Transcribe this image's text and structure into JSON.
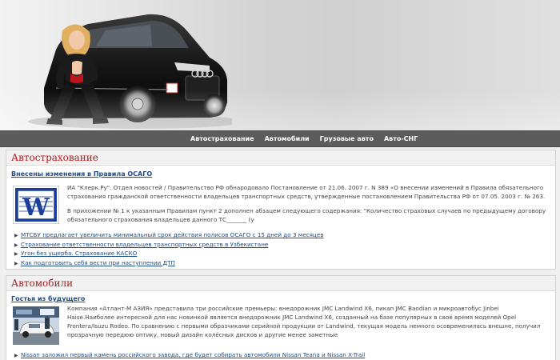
{
  "nav": {
    "items": [
      "Автострахование",
      "Автомобили",
      "Грузовые авто",
      "Авто-СНГ"
    ]
  },
  "sections": [
    {
      "title": "Автострахование",
      "article_title": "Внесены изменения в Правила ОСАГО",
      "paragraphs": [
        "ИА \"Клерк.Ру\". Отдел новостей / Правительство РФ обнародовало Постановление от 21.06. 2007 г. N 389 «О внесении изменений в Правила обязательного страхования гражданской ответственности владельцев транспортных средств, утвержденные постановлением Правительства РФ от 07.05. 2003 г. № 263.",
        "В приложении № 1 к указанным Правилам пункт 2 дополнен абзацем следующего содержания: \"Количество страховых случаев по предыдущему договору обязательного страхования владельцев данного ТС_______ (у"
      ],
      "links": [
        "МТСБУ предлагает увеличить минимальный срок действия полисов ОСАГО с 15 дней до 3 месяцев",
        "Страхование ответственности владельцев транспортных средств в Узбекистане",
        "Угон без ущерба. Страхование КАСКО",
        "Как подготовить себя вести при наступлении ДТП"
      ],
      "icon_letter": "W"
    },
    {
      "title": "Автомобили",
      "article_title": "Гостья из будущего",
      "paragraphs": [
        "Компания «Атлант-М АЗИЯ» представила три российские премьеры: внедорожник JMC Landwind X6, пикап JMC Baodian и микроавтобус Jinbei Haise.Наиболее интересной для нас новинкой является внедорожник JMC Landwind X6, созданный на базе популярных в своё время моделей Opel Frontera/Isuzu Rodeo. По сравнению с первыми образчиками серийной продукции от Landwind, текущая модель немного осовременилась внешне, получил прозрачную передюю оптику, новый дизайн колёсных дисков и другие менее заметные"
      ],
      "links": [
        "Nissan заложил первый камень российского завода, где будет собирать автомобили Nissan Teana и Nissan X-Trail"
      ]
    }
  ]
}
